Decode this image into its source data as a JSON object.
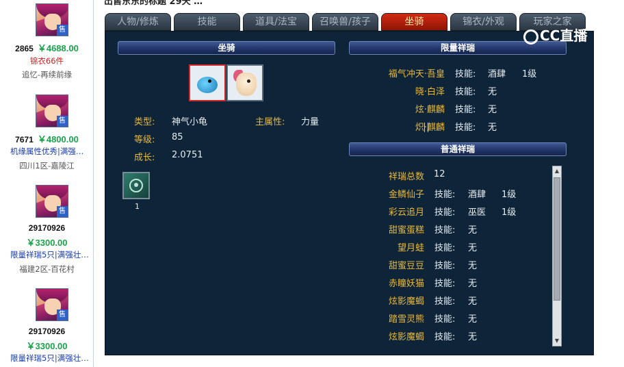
{
  "top_header": {
    "text": "出售东东的标题  29天 …"
  },
  "listings": [
    {
      "id": "2865",
      "price": "￥4688.00",
      "line1": "锦衣66件",
      "line1_color": "red",
      "line2": "追忆-再续前缘"
    },
    {
      "id": "7671",
      "price": "￥4800.00",
      "line1": "机缘属性优秀|满强…",
      "line1_color": "blue",
      "line2": "四川1区-嘉陵江"
    },
    {
      "id": "29170926",
      "price": "￥3300.00",
      "line1": "限量祥瑞5只|满强壮…",
      "line1_color": "blue",
      "line2": "福建2区-百花村"
    },
    {
      "id": "29170926",
      "price": "￥3300.00",
      "line1": "限量祥瑞5只|满强壮…",
      "line1_color": "blue",
      "line2": ""
    }
  ],
  "sell_badge": "售",
  "tabs": [
    {
      "label": "人物/修炼",
      "active": false
    },
    {
      "label": "技能",
      "active": false
    },
    {
      "label": "道具/法宝",
      "active": false
    },
    {
      "label": "召唤兽/孩子",
      "active": false
    },
    {
      "label": "坐骑",
      "active": true
    },
    {
      "label": "锦衣/外观",
      "active": false
    },
    {
      "label": "玩家之家",
      "active": false
    }
  ],
  "mount_panel": {
    "title": "坐骑",
    "attrs": {
      "type_label": "类型:",
      "type_value": "神气小龟",
      "main_label": "主属性:",
      "main_value": "力量",
      "level_label": "等级:",
      "level_value": "85",
      "growth_label": "成长:",
      "growth_value": "2.0751"
    },
    "skill_count": "1"
  },
  "limited_panel": {
    "title": "限量祥瑞",
    "items": [
      {
        "name": "福气冲天·吾皇",
        "skill": "技能:",
        "skill_value": "酒肆",
        "level": "1级"
      },
      {
        "name": "晓·白泽",
        "skill": "技能:",
        "skill_value": "无",
        "level": ""
      },
      {
        "name": "炫·麒麟",
        "skill": "技能:",
        "skill_value": "无",
        "level": ""
      },
      {
        "name": "炽·麒麟",
        "skill": "技能:",
        "skill_value": "无",
        "level": ""
      }
    ]
  },
  "normal_panel": {
    "title": "普通祥瑞",
    "total_label": "祥瑞总数",
    "total_value": "12",
    "items": [
      {
        "name": "金鳞仙子",
        "skill": "技能:",
        "skill_value": "酒肆",
        "level": "1级"
      },
      {
        "name": "彩云追月",
        "skill": "技能:",
        "skill_value": "巫医",
        "level": "1级"
      },
      {
        "name": "甜蜜蛋糕",
        "skill": "技能:",
        "skill_value": "无",
        "level": ""
      },
      {
        "name": "望月蛙",
        "skill": "技能:",
        "skill_value": "无",
        "level": ""
      },
      {
        "name": "甜蜜豆豆",
        "skill": "技能:",
        "skill_value": "无",
        "level": ""
      },
      {
        "name": "赤瞳妖猫",
        "skill": "技能:",
        "skill_value": "无",
        "level": ""
      },
      {
        "name": "炫影魔蝎",
        "skill": "技能:",
        "skill_value": "无",
        "level": ""
      },
      {
        "name": "踏雪灵熊",
        "skill": "技能:",
        "skill_value": "无",
        "level": ""
      },
      {
        "name": "炫影魔蝎",
        "skill": "技能:",
        "skill_value": "无",
        "level": ""
      }
    ]
  },
  "watermark": "CC直播",
  "colors": {
    "tab_active": "#c0200c",
    "panel_bg": "#0e2438",
    "label_gold": "#e8b83a",
    "price_green": "#1aa34a"
  }
}
